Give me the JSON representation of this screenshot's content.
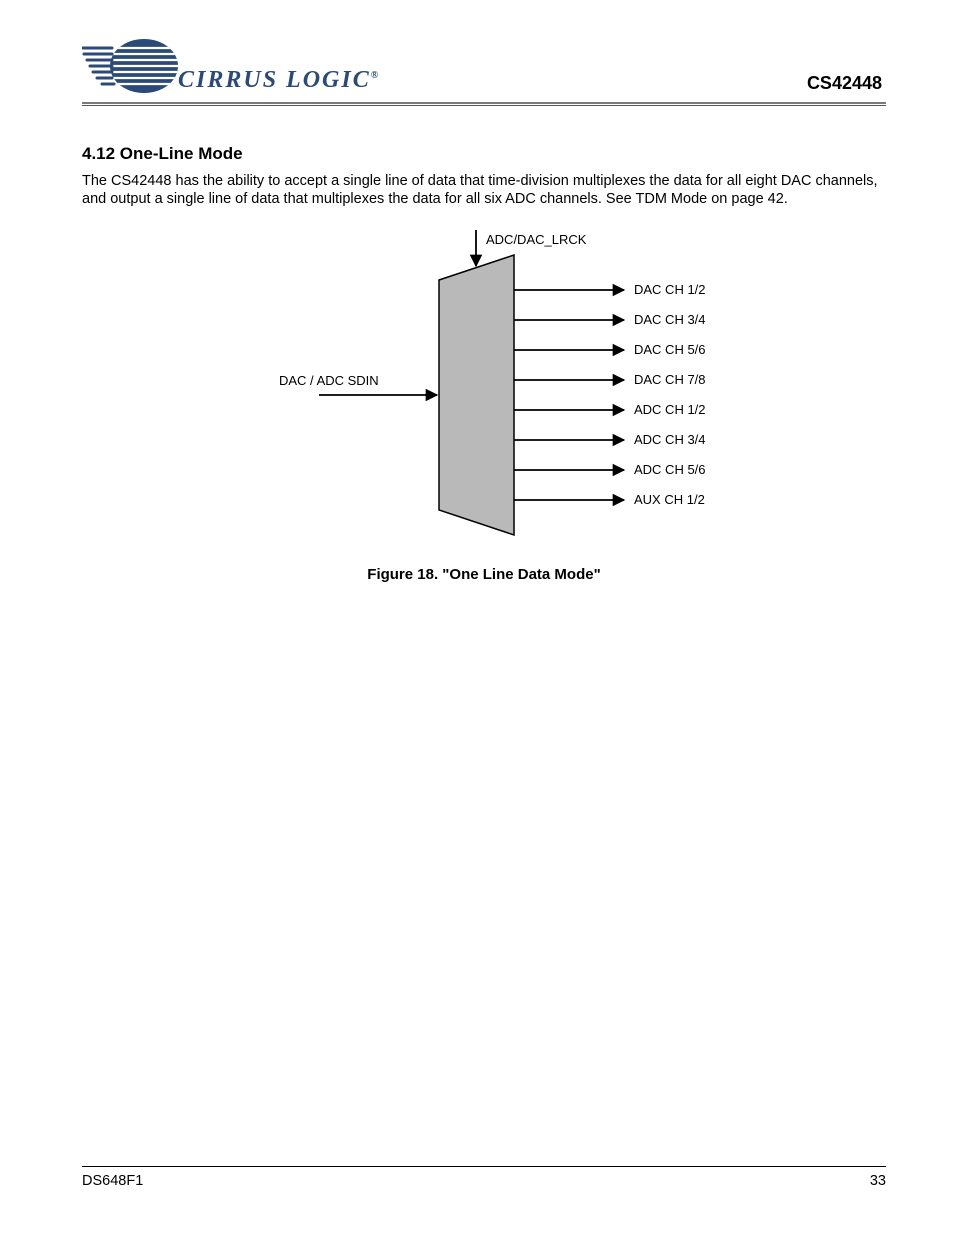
{
  "header": {
    "logo_text": "CIRRUS LOGIC",
    "doc_id": "CS42448"
  },
  "section": {
    "number_title": "4.12 One-Line Mode",
    "paragraph": "The CS42448 has the ability to accept a single line of data that time-division multiplexes the data for all eight DAC channels, and output a single line of data that multiplexes the data for all six ADC channels. See TDM Mode on page 42."
  },
  "figure": {
    "top_label": "ADC/DAC_LRCK",
    "left_label": "DAC / ADC SDIN",
    "outputs": [
      "DAC CH 1/2",
      "DAC CH 3/4",
      "DAC CH 5/6",
      "DAC CH 7/8",
      "ADC CH 1/2",
      "ADC CH 3/4",
      "ADC CH 5/6",
      "AUX CH 1/2"
    ],
    "caption": "Figure 18. \"One Line Data Mode\""
  },
  "footer": {
    "left": "DS648F1",
    "right": "33"
  }
}
